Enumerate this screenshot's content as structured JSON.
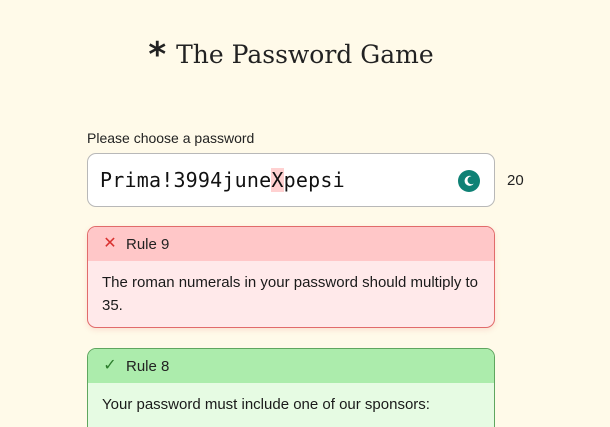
{
  "header": {
    "star": "*",
    "title": "The Password Game"
  },
  "password": {
    "label": "Please choose a password",
    "before": "Prima!3994june",
    "highlighted": "X",
    "after": "pepsi",
    "length": "20",
    "moon_icon": "moon-icon"
  },
  "rules": [
    {
      "status": "failed",
      "icon": "x-icon",
      "icon_glyph": "✕",
      "title": "Rule 9",
      "text": "The roman numerals in your password should multiply to 35.",
      "color_head": "#ffc7c8"
    },
    {
      "status": "passed",
      "icon": "check-icon",
      "icon_glyph": "✓",
      "title": "Rule 8",
      "text": "Your password must include one of our sponsors:",
      "color_head": "#acecac"
    }
  ]
}
